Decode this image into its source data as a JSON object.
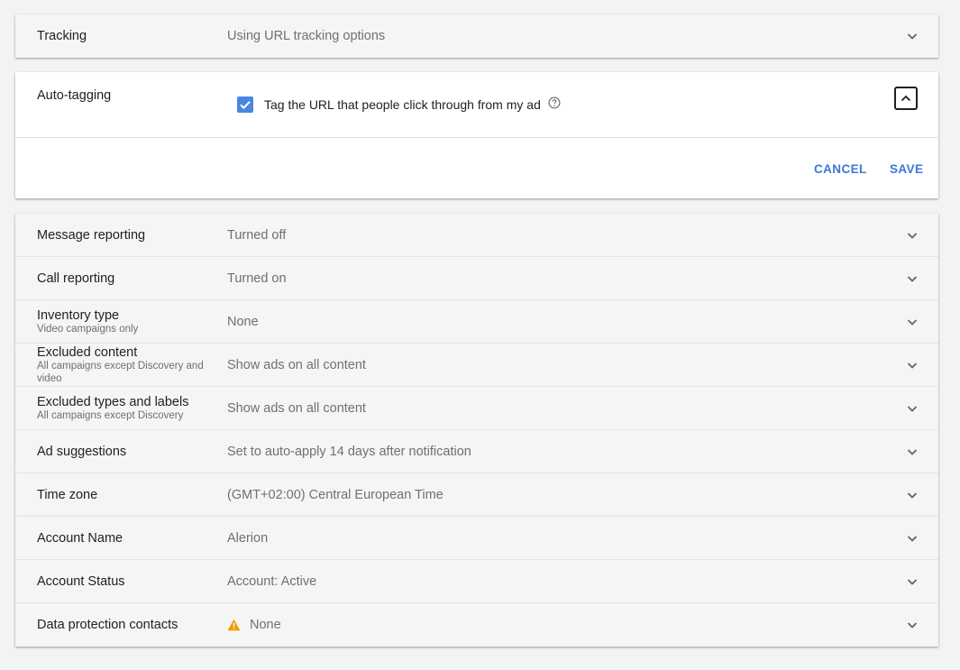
{
  "tracking": {
    "label": "Tracking",
    "value": "Using URL tracking options"
  },
  "auto_tagging": {
    "label": "Auto-tagging",
    "checkbox_label": "Tag the URL that people click through from my ad",
    "checked": true,
    "cancel_label": "CANCEL",
    "save_label": "SAVE"
  },
  "settings": [
    {
      "label": "Message reporting",
      "sublabel": "",
      "value": "Turned off"
    },
    {
      "label": "Call reporting",
      "sublabel": "",
      "value": "Turned on"
    },
    {
      "label": "Inventory type",
      "sublabel": "Video campaigns only",
      "value": "None"
    },
    {
      "label": "Excluded content",
      "sublabel": "All campaigns except Discovery and video",
      "value": "Show ads on all content"
    },
    {
      "label": "Excluded types and labels",
      "sublabel": "All campaigns except Discovery",
      "value": "Show ads on all content"
    },
    {
      "label": "Ad suggestions",
      "sublabel": "",
      "value": "Set to auto-apply 14 days after notification"
    },
    {
      "label": "Time zone",
      "sublabel": "",
      "value": "(GMT+02:00) Central European Time"
    },
    {
      "label": "Account Name",
      "sublabel": "",
      "value": "Alerion"
    },
    {
      "label": "Account Status",
      "sublabel": "",
      "value": "Account: Active"
    },
    {
      "label": "Data protection contacts",
      "sublabel": "",
      "value": "None"
    }
  ],
  "colors": {
    "accent": "#3c78d8",
    "checkbox": "#4a86e0",
    "warning": "#f29900",
    "background": "#f1f3f4"
  },
  "icons": {
    "expand": "chevron-down-icon",
    "collapse": "chevron-up-icon",
    "help": "help-circle-icon",
    "warning": "warning-triangle-icon",
    "check": "checkmark-icon"
  }
}
